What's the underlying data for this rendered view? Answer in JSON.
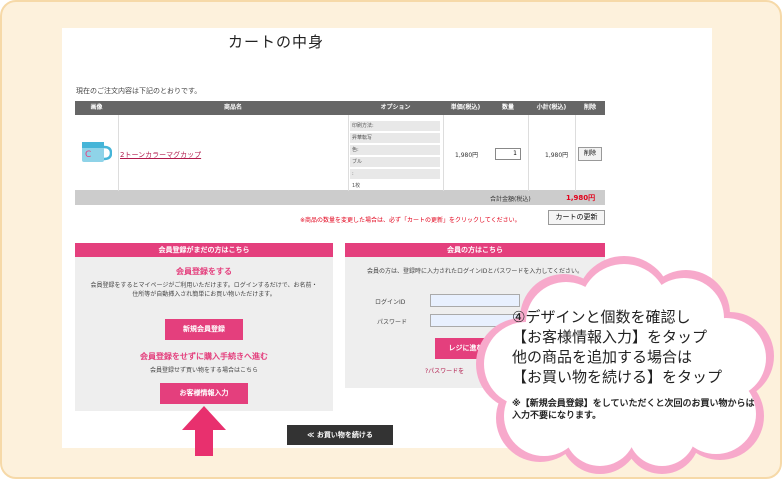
{
  "page": {
    "title": "カートの中身",
    "notice": "現在のご注文内容は下記のとおりです。"
  },
  "cart": {
    "headers": [
      "画像",
      "商品名",
      "オプション",
      "単価(税込)",
      "数量",
      "小計(税込)",
      "削除"
    ],
    "item": {
      "name": "2トーンカラーマグカップ",
      "options": [
        "印刷方法:",
        "昇華転写",
        "色:",
        "ブル",
        ":",
        "1枚"
      ],
      "unit_price": "1,980円",
      "quantity": "1",
      "subtotal": "1,980円",
      "delete_label": "削除"
    },
    "total_label": "合計金額(税込)",
    "total_value": "1,980円",
    "warning": "※商品の数量を変更した場合は、必ず「カートの更新」をクリックしてください。",
    "update_label": "カートの更新"
  },
  "guest_panel": {
    "header": "会員登録がまだの方はこちら",
    "register_title": "会員登録をする",
    "register_desc": "会員登録をするとマイページがご利用いただけます。ログインするだけで、お名前・住所等が自動挿入され簡単にお買い物いただけます。",
    "register_button": "新規会員登録",
    "guest_title": "会員登録をせずに購入手続きへ進む",
    "guest_desc": "会員登録せず買い物をする場合はこちら",
    "guest_button": "お客様情報入力"
  },
  "member_panel": {
    "header": "会員の方はこちら",
    "desc": "会員の方は、登録時に入力されたログインIDとパスワードを入力してください。",
    "login_label": "ログインID",
    "password_label": "パスワード",
    "login_button": "レジに進む",
    "forgot": "?パスワードを"
  },
  "continue_button": "≪ お買い物を続ける",
  "callout": {
    "lines": [
      "④デザインと個数を確認し",
      "【お客様情報入力】をタップ",
      "他の商品を追加する場合は",
      "【お買い物を続ける】をタップ"
    ],
    "note": "※【新規会員登録】をしていただくと次回のお買い物からは入力不要になります。"
  },
  "colors": {
    "accent": "#e43f7d",
    "price": "#e2001a",
    "arrow": "#e8306e",
    "cloud": "#f7a9cb"
  }
}
